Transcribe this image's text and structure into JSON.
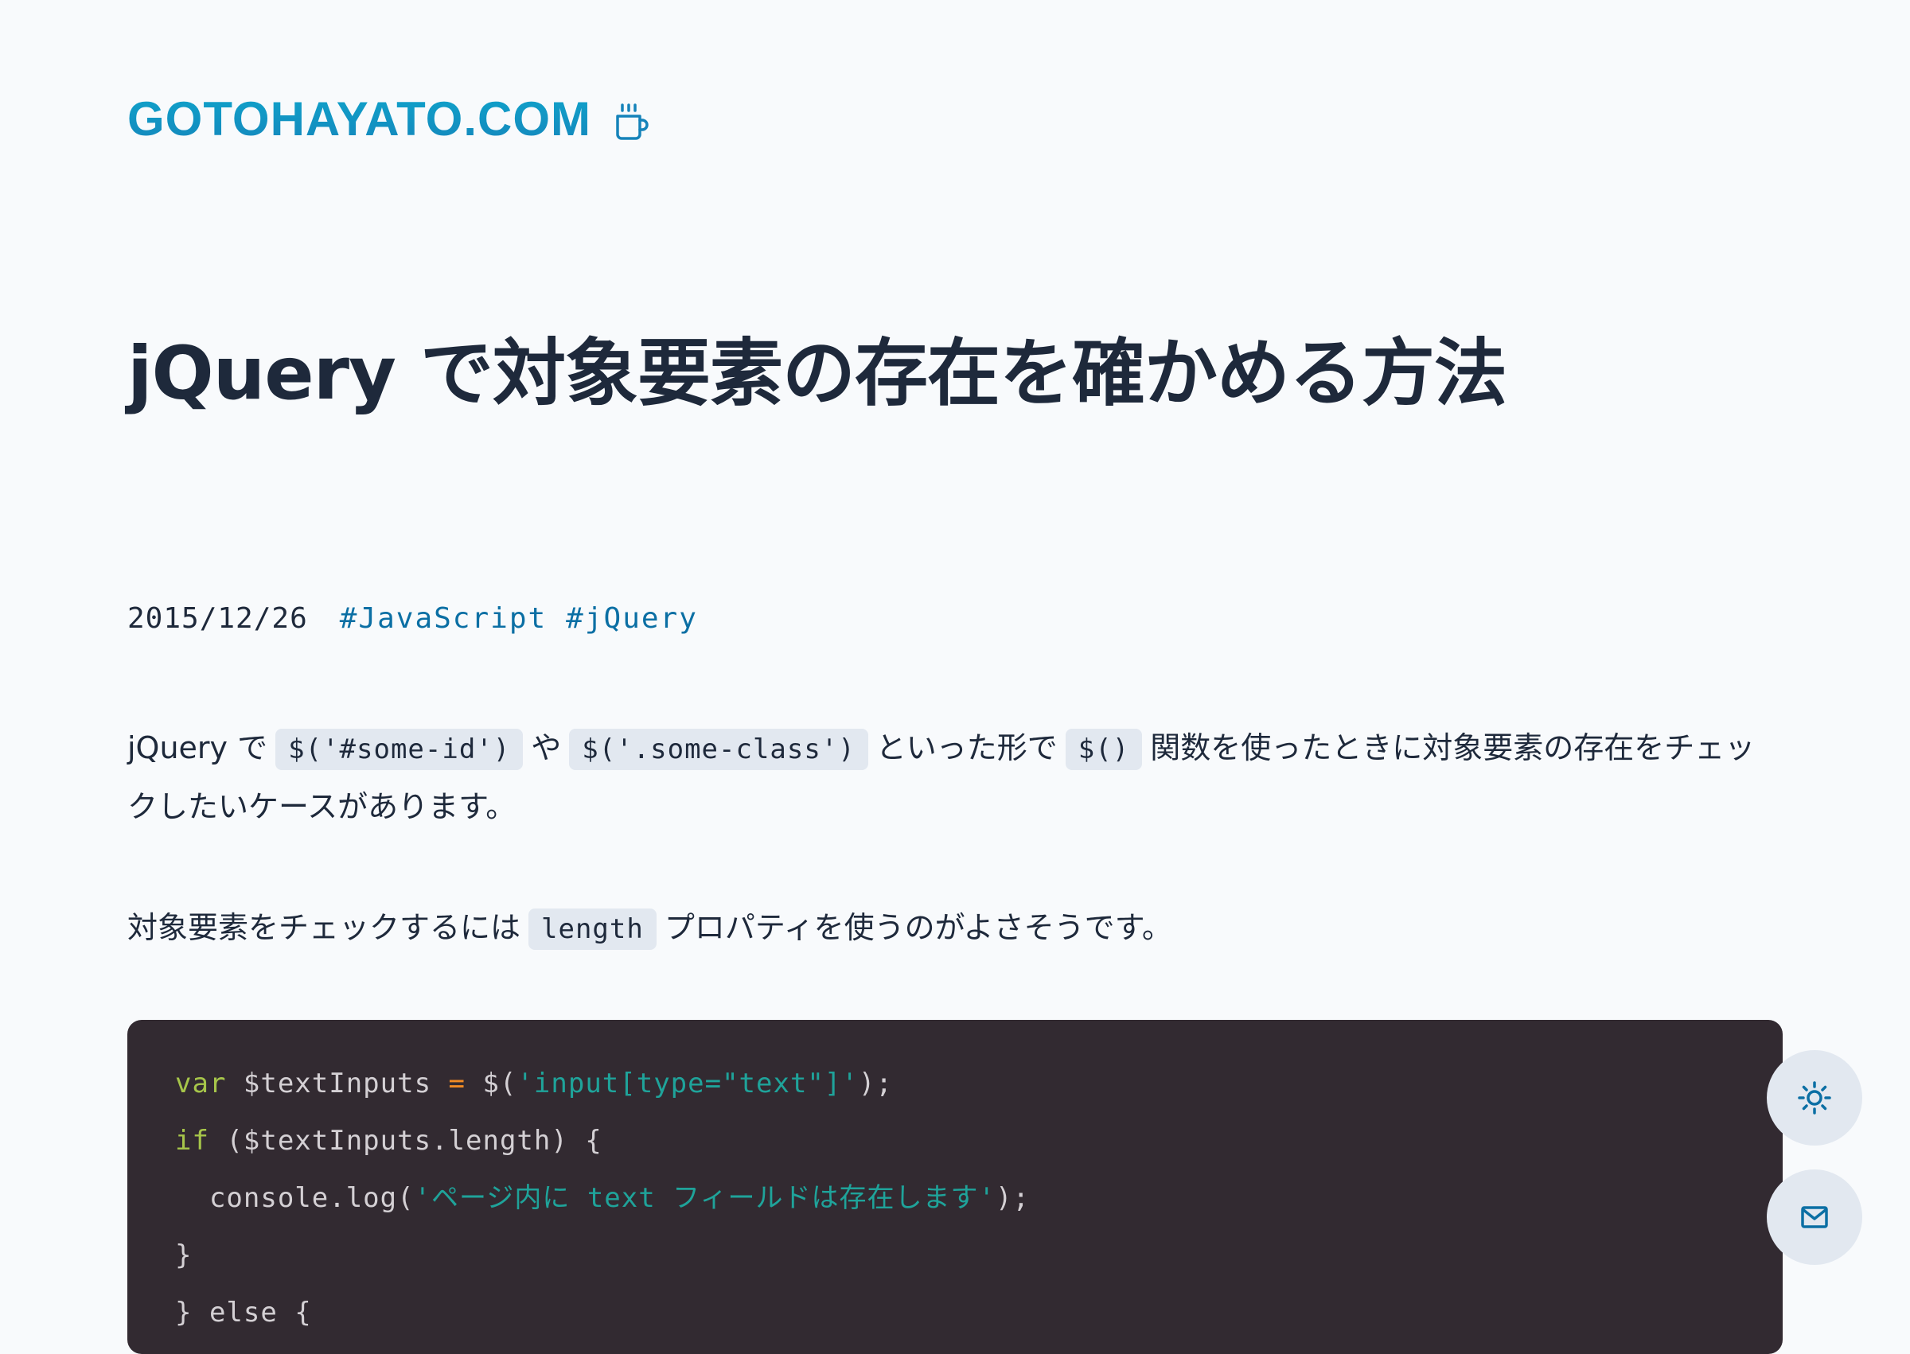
{
  "header": {
    "site_name": "GOTOHAYATO.COM",
    "logo_icon": "coffee-cup-icon"
  },
  "post": {
    "title": "jQuery で対象要素の存在を確かめる方法",
    "date": "2015/12/26",
    "tags": [
      "#JavaScript",
      "#jQuery"
    ],
    "paragraphs": {
      "p1": {
        "t1": "jQuery で",
        "c1": "$('#some-id')",
        "t2": "や",
        "c2": "$('.some-class')",
        "t3": "といった形で",
        "c3": "$()",
        "t4": "関数を使ったときに対象要素の存在をチェックしたいケースがあります。"
      },
      "p2": {
        "t1": "対象要素をチェックするには",
        "c1": "length",
        "t2": "プロパティを使うのがよさそうです。"
      }
    },
    "code": {
      "line1": {
        "kw": "var",
        "a": " $textInputs ",
        "op": "=",
        "b": " $(",
        "str": "'input[type=\"text\"]'",
        "c": ");"
      },
      "line2": {
        "kw": "if",
        "a": " ($textInputs.length) {"
      },
      "line3": {
        "a": "  console.log(",
        "str": "'ページ内に text フィールドは存在します'",
        "b": ");"
      },
      "line4": {
        "a": "}"
      },
      "line5": {
        "a": "} else {"
      }
    }
  },
  "floating_buttons": {
    "theme_toggle": "sun-icon",
    "contact": "mail-icon"
  },
  "colors": {
    "background": "#f8fafc",
    "text": "#1e293b",
    "accent": "#0b6fa4",
    "logo": "#1583ba",
    "code_bg": "#322a31",
    "inline_code_bg": "#e2e8f0",
    "code_keyword": "#a6c54a",
    "code_operator": "#f18b24",
    "code_string": "#1fa39a"
  }
}
